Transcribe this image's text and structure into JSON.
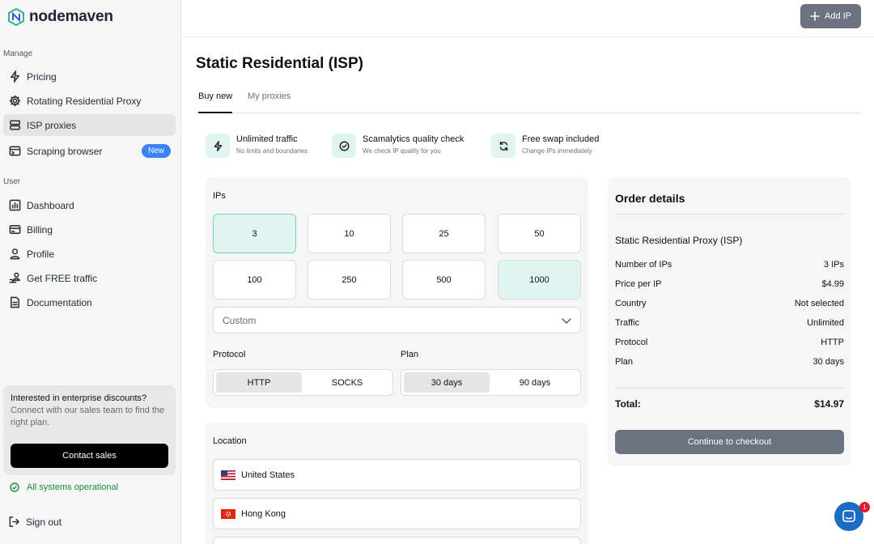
{
  "app": {
    "name": "nodemaven"
  },
  "sidebar": {
    "manage_label": "Manage",
    "manage_items": [
      {
        "label": "Pricing",
        "icon": "lightning-icon"
      },
      {
        "label": "Rotating Residential Proxy",
        "icon": "gear-icon"
      },
      {
        "label": "ISP proxies",
        "icon": "server-icon"
      },
      {
        "label": "Scraping browser",
        "icon": "browser-icon",
        "badge": "New"
      }
    ],
    "user_label": "User",
    "user_items": [
      {
        "label": "Dashboard",
        "icon": "chart-icon"
      },
      {
        "label": "Billing",
        "icon": "credit-card-icon"
      },
      {
        "label": "Profile",
        "icon": "user-icon"
      },
      {
        "label": "Get FREE traffic",
        "icon": "referral-icon"
      },
      {
        "label": "Documentation",
        "icon": "document-icon"
      }
    ],
    "promo": {
      "title": "Interested in enterprise discounts?",
      "text": "Connect with our sales team to find the right plan.",
      "button": "Contact sales"
    },
    "status": "All systems operational",
    "signout": "Sign out"
  },
  "header": {
    "add_ip": "Add IP"
  },
  "main": {
    "title": "Static Residential (ISP)",
    "tabs": [
      {
        "label": "Buy new"
      },
      {
        "label": "My proxies"
      }
    ],
    "features": [
      {
        "title": "Unlimited traffic",
        "subtitle": "No limits and boundaries",
        "icon": "lightning-icon"
      },
      {
        "title": "Scamalytics quality check",
        "subtitle": "We check IP quality for you",
        "icon": "check-circle-icon"
      },
      {
        "title": "Free swap included",
        "subtitle": "Change IPs immediately",
        "icon": "refresh-icon"
      }
    ],
    "ips_label": "IPs",
    "ip_options": [
      "3",
      "10",
      "25",
      "50",
      "100",
      "250",
      "500",
      "1000"
    ],
    "selected_ip": "3",
    "custom_placeholder": "Custom",
    "protocol_label": "Protocol",
    "protocol_options": [
      "HTTP",
      "SOCKS"
    ],
    "plan_label": "Plan",
    "plan_options": [
      "30 days",
      "90 days"
    ],
    "location_label": "Location",
    "locations": [
      {
        "name": "United States"
      },
      {
        "name": "Hong Kong"
      }
    ]
  },
  "order": {
    "title": "Order details",
    "product": "Static Residential Proxy (ISP)",
    "rows": [
      {
        "label": "Number of IPs",
        "value": "3 IPs"
      },
      {
        "label": "Price per IP",
        "value": "$4.99"
      },
      {
        "label": "Country",
        "value": "Not selected"
      },
      {
        "label": "Traffic",
        "value": "Unlimited"
      },
      {
        "label": "Protocol",
        "value": "HTTP"
      },
      {
        "label": "Plan",
        "value": "30 days"
      }
    ],
    "total_label": "Total:",
    "total_value": "$14.97",
    "checkout": "Continue to checkout"
  },
  "chat": {
    "badge_count": "1"
  },
  "colors": {
    "accent_mint": "#e0f5ef",
    "primary_gray": "#6b7280",
    "badge_blue": "#3b82f6",
    "status_green": "#1b8a3c"
  }
}
